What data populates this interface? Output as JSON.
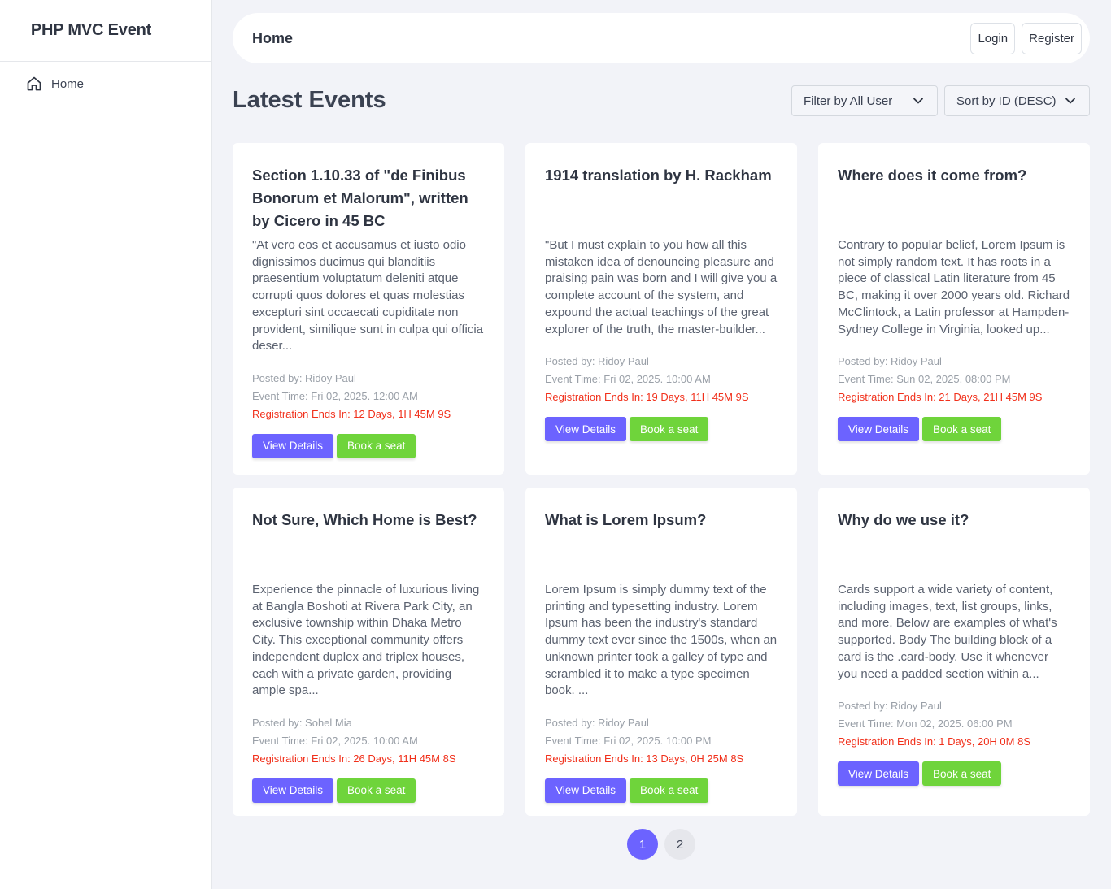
{
  "sidebar": {
    "brand": "PHP MVC Event",
    "items": [
      {
        "label": "Home",
        "icon": "home-icon"
      }
    ]
  },
  "topbar": {
    "title": "Home",
    "login_label": "Login",
    "register_label": "Register"
  },
  "main": {
    "title": "Latest Events",
    "filter_label": "Filter by All User",
    "sort_label": "Sort by ID (DESC)"
  },
  "events": [
    {
      "title": "Section 1.10.33 of \"de Finibus Bonorum et Malorum\", written by Cicero in 45 BC",
      "excerpt": "\"At vero eos et accusamus et iusto odio dignissimos ducimus qui blanditiis praesentium voluptatum deleniti atque corrupti quos dolores et quas molestias excepturi sint occaecati cupiditate non provident, similique sunt in culpa qui officia deser...",
      "posted_by": "Posted by: Ridoy Paul",
      "event_time": "Event Time: Fri 02, 2025. 12:00 AM",
      "registration": "Registration Ends In: 12 Days, 1H 45M 9S"
    },
    {
      "title": "1914 translation by H. Rackham",
      "excerpt": "\"But I must explain to you how all this mistaken idea of denouncing pleasure and praising pain was born and I will give you a complete account of the system, and expound the actual teachings of the great explorer of the truth, the master-builder...",
      "posted_by": "Posted by: Ridoy Paul",
      "event_time": "Event Time: Fri 02, 2025. 10:00 AM",
      "registration": "Registration Ends In: 19 Days, 11H 45M 9S"
    },
    {
      "title": "Where does it come from?",
      "excerpt": "Contrary to popular belief, Lorem Ipsum is not simply random text. It has roots in a piece of classical Latin literature from 45 BC, making it over 2000 years old. Richard McClintock, a Latin professor at Hampden-Sydney College in Virginia, looked up...",
      "posted_by": "Posted by: Ridoy Paul",
      "event_time": "Event Time: Sun 02, 2025. 08:00 PM",
      "registration": "Registration Ends In: 21 Days, 21H 45M 9S"
    },
    {
      "title": "Not Sure, Which Home is Best?",
      "excerpt": "Experience the pinnacle of luxurious living at Bangla Boshoti at Rivera Park City, an exclusive township within Dhaka Metro City. This exceptional community offers independent duplex and triplex houses, each with a private garden, providing ample spa...",
      "posted_by": "Posted by: Sohel Mia",
      "event_time": "Event Time: Fri 02, 2025. 10:00 AM",
      "registration": "Registration Ends In: 26 Days, 11H 45M 8S"
    },
    {
      "title": "What is Lorem Ipsum?",
      "excerpt": "Lorem Ipsum is simply dummy text of the printing and typesetting industry. Lorem Ipsum has been the industry's standard dummy text ever since the 1500s, when an unknown printer took a galley of type and scrambled it to make a type specimen book. ...",
      "posted_by": "Posted by: Ridoy Paul",
      "event_time": "Event Time: Fri 02, 2025. 10:00 PM",
      "registration": "Registration Ends In: 13 Days, 0H 25M 8S"
    },
    {
      "title": "Why do we use it?",
      "excerpt": "Cards support a wide variety of content, including images, text, list groups, links, and more. Below are examples of what's supported. Body The building block of a card is the .card-body. Use it whenever you need a padded section within a...",
      "posted_by": "Posted by: Ridoy Paul",
      "event_time": "Event Time: Mon 02, 2025. 06:00 PM",
      "registration": "Registration Ends In: 1 Days, 20H 0M 8S"
    }
  ],
  "card_actions": {
    "view_label": "View Details",
    "book_label": "Book a seat"
  },
  "pagination": {
    "pages": [
      "1",
      "2"
    ],
    "active": "1"
  },
  "colors": {
    "accent": "#6c63ff",
    "book": "#6fd43b",
    "countdown": "#f1301b",
    "background": "#f2f3f8"
  }
}
